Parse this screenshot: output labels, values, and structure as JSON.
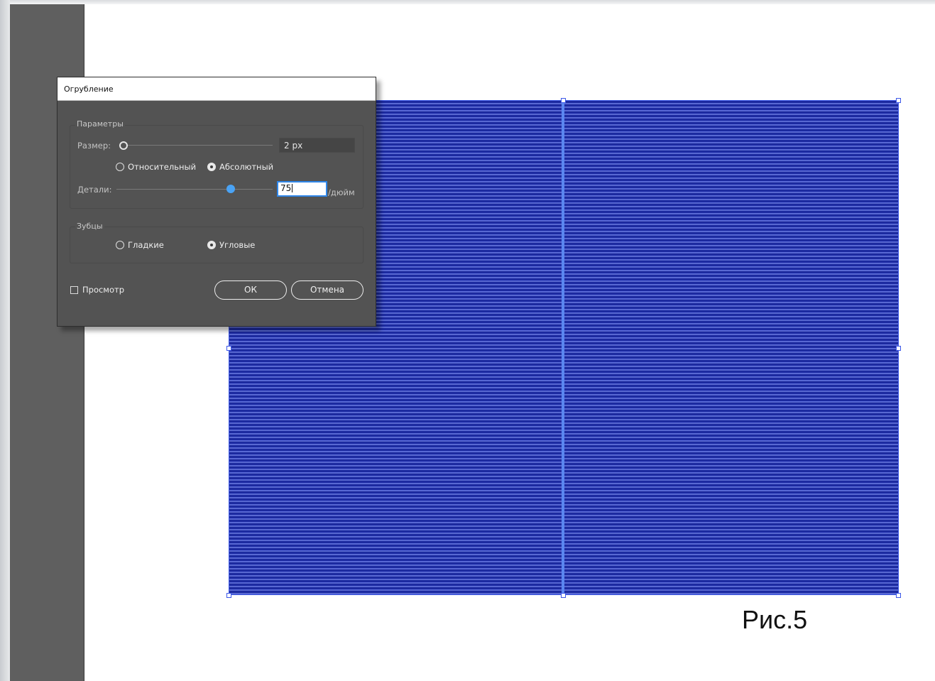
{
  "dialog": {
    "title": "Огрубление",
    "params_group": "Параметры",
    "size_label": "Размер:",
    "size_value": "2 px",
    "size_level": 0.0,
    "mode_relative": "Относительный",
    "mode_absolute": "Абсолютный",
    "mode_selected": "absolute",
    "detail_label": "Детали:",
    "detail_value": "75",
    "detail_level": 0.75,
    "detail_unit": "/дюйм",
    "teeth_group": "Зубцы",
    "teeth_smooth": "Гладкие",
    "teeth_corner": "Угловые",
    "teeth_selected": "corner",
    "preview_label": "Просмотр",
    "preview_checked": false,
    "ok_label": "ОК",
    "cancel_label": "Отмена"
  },
  "canvas": {
    "caption": "Рис.5",
    "stripe_color": "#1c2aa0",
    "guide_color": "#5a86f0"
  }
}
